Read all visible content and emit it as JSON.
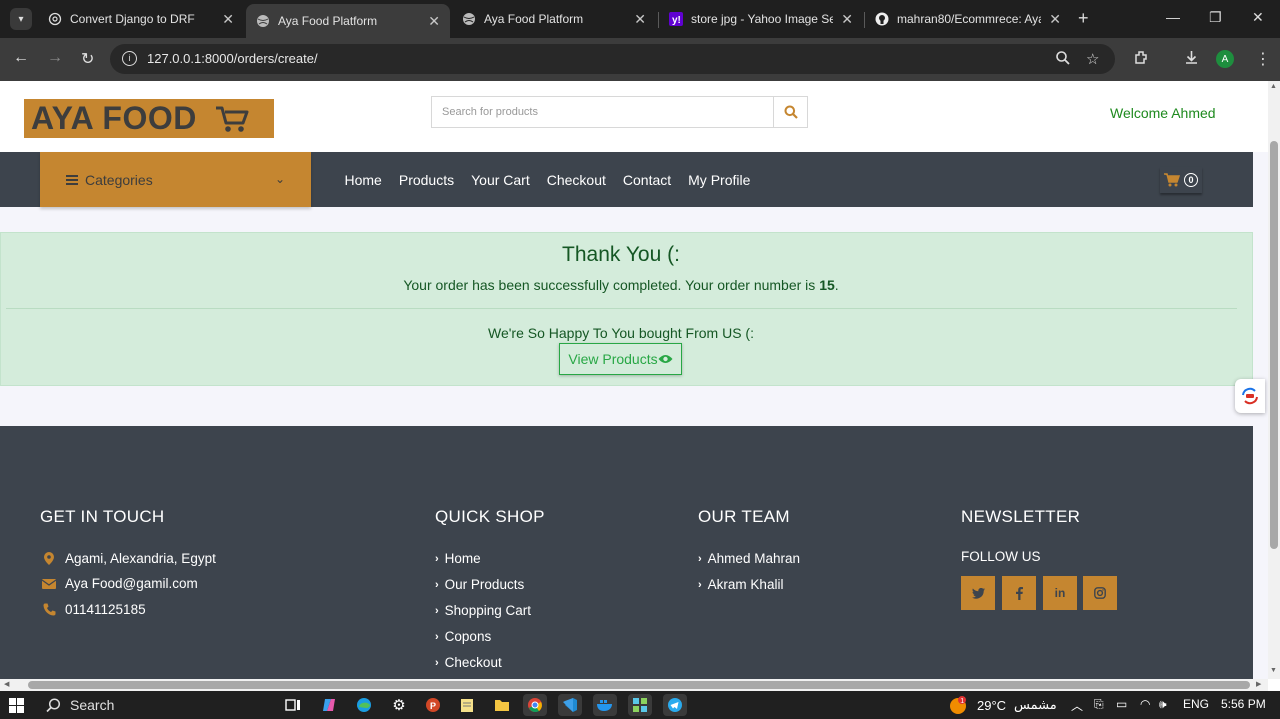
{
  "browser": {
    "tabs": [
      {
        "title": "Convert Django to DRF",
        "icon": "chatgpt-icon",
        "active": false
      },
      {
        "title": "Aya Food Platform",
        "icon": "globe-icon",
        "active": true
      },
      {
        "title": "Aya Food Platform",
        "icon": "globe-icon",
        "active": false
      },
      {
        "title": "store jpg - Yahoo Image Sea",
        "icon": "yahoo-icon",
        "active": false
      },
      {
        "title": "mahran80/Ecommrece: Aya",
        "icon": "github-icon",
        "active": false
      }
    ],
    "url": "127.0.0.1:8000/orders/create/",
    "profile_initial": "A"
  },
  "header": {
    "logo_text": "AYA FOOD",
    "search_placeholder": "Search for products",
    "welcome": "Welcome Ahmed"
  },
  "nav": {
    "categories_label": "Categories",
    "links": [
      "Home",
      "Products",
      "Your Cart",
      "Checkout",
      "Contact",
      "My Profile"
    ],
    "cart_count": "0"
  },
  "alert": {
    "title": "Thank You (:",
    "message": "Your order has been successfully completed. Your order number is",
    "order_number": "15",
    "message_end": ".",
    "happy": "We're So Happy To You bought From US (:",
    "button": "View Products"
  },
  "footer": {
    "contact": {
      "heading": "GET IN TOUCH",
      "address": "Agami, Alexandria, Egypt",
      "email": "Aya Food@gamil.com",
      "phone": "01141125185"
    },
    "quick_shop": {
      "heading": "QUICK SHOP",
      "links": [
        "Home",
        "Our Products",
        "Shopping Cart",
        "Copons",
        "Checkout"
      ]
    },
    "team": {
      "heading": "OUR TEAM",
      "members": [
        "Ahmed Mahran",
        "Akram Khalil"
      ]
    },
    "newsletter": {
      "heading": "NEWSLETTER",
      "follow": "FOLLOW US",
      "social": [
        "twitter-icon",
        "facebook-icon",
        "linkedin-icon",
        "instagram-icon"
      ]
    }
  },
  "colors": {
    "brand": "#c58630",
    "dark": "#3d444d",
    "success": "#155724"
  },
  "taskbar": {
    "search_label": "Search",
    "temperature": "29°C",
    "weather_text": "مشمس",
    "language": "ENG",
    "time": "5:56 PM",
    "weather_badge": "1"
  }
}
